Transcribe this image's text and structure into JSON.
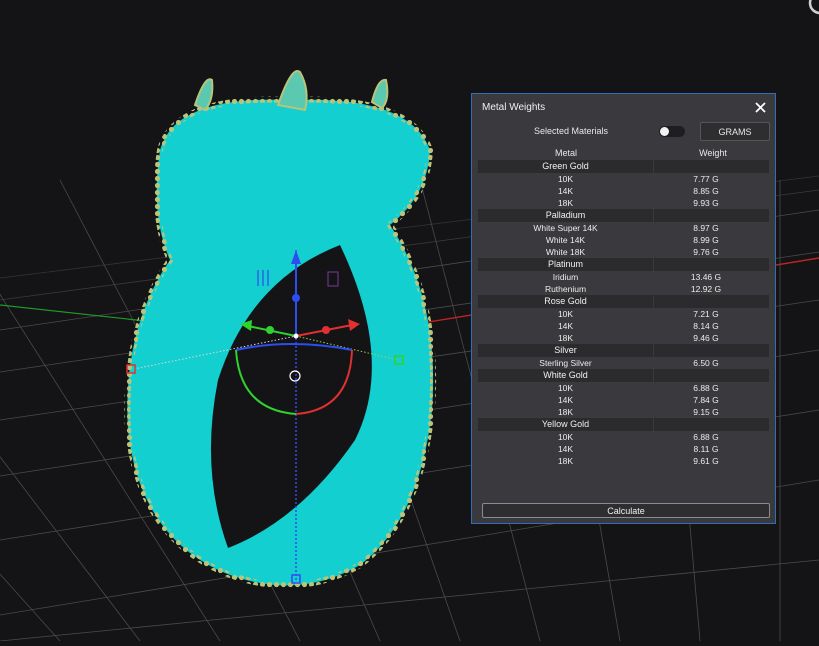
{
  "panel": {
    "title": "Metal Weights",
    "selected_label": "Selected Materials",
    "toggle_on": false,
    "units_label": "GRAMS",
    "col_metal": "Metal",
    "col_weight": "Weight",
    "calculate_label": "Calculate",
    "groups": [
      {
        "name": "Green Gold",
        "items": [
          {
            "name": "10K",
            "weight": "7.77 G"
          },
          {
            "name": "14K",
            "weight": "8.85 G"
          },
          {
            "name": "18K",
            "weight": "9.93 G"
          }
        ]
      },
      {
        "name": "Palladium",
        "items": [
          {
            "name": "White Super 14K",
            "weight": "8.97 G"
          },
          {
            "name": "White 14K",
            "weight": "8.99 G"
          },
          {
            "name": "White 18K",
            "weight": "9.76 G"
          }
        ]
      },
      {
        "name": "Platinum",
        "items": [
          {
            "name": "Iridium",
            "weight": "13.46 G"
          },
          {
            "name": "Ruthenium",
            "weight": "12.92 G"
          }
        ]
      },
      {
        "name": "Rose Gold",
        "items": [
          {
            "name": "10K",
            "weight": "7.21 G"
          },
          {
            "name": "14K",
            "weight": "8.14 G"
          },
          {
            "name": "18K",
            "weight": "9.46 G"
          }
        ]
      },
      {
        "name": "Silver",
        "items": [
          {
            "name": "Sterling Silver",
            "weight": "6.50 G"
          }
        ]
      },
      {
        "name": "White Gold",
        "items": [
          {
            "name": "10K",
            "weight": "6.88 G"
          },
          {
            "name": "14K",
            "weight": "7.84 G"
          },
          {
            "name": "18K",
            "weight": "9.15 G"
          }
        ]
      },
      {
        "name": "Yellow Gold",
        "items": [
          {
            "name": "10K",
            "weight": "6.88 G"
          },
          {
            "name": "14K",
            "weight": "8.11 G"
          },
          {
            "name": "18K",
            "weight": "9.61 G"
          }
        ]
      }
    ]
  },
  "colors": {
    "model": "#14cfcf",
    "accent_border": "#2f6fb5",
    "axis_x": "#e03030",
    "axis_y": "#2fd22f",
    "axis_z": "#2d4df0"
  }
}
